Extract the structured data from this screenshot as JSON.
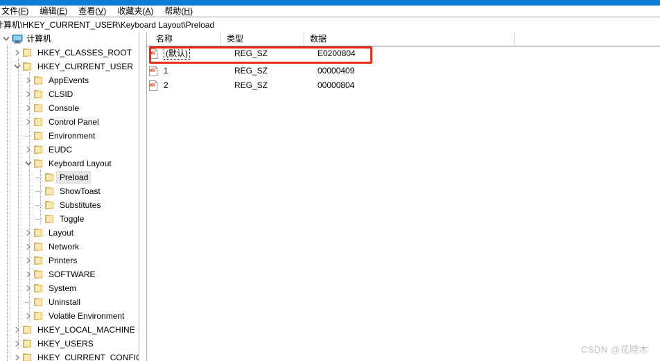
{
  "window": {
    "titlebar_color": "#0b7fd4"
  },
  "menubar": {
    "items": [
      {
        "name": "file",
        "text": "文件(F)",
        "label": "文件",
        "mnemonic": "F"
      },
      {
        "name": "edit",
        "text": "编辑(E)",
        "label": "编辑",
        "mnemonic": "E"
      },
      {
        "name": "view",
        "text": "查看(V)",
        "label": "查看",
        "mnemonic": "V"
      },
      {
        "name": "favorites",
        "text": "收藏夹(A)",
        "label": "收藏夹",
        "mnemonic": "A"
      },
      {
        "name": "help",
        "text": "帮助(H)",
        "label": "帮助",
        "mnemonic": "H"
      }
    ]
  },
  "address": {
    "path": "计算机\\HKEY_CURRENT_USER\\Keyboard Layout\\Preload"
  },
  "tree": {
    "items": [
      {
        "label": "计算机",
        "depth": 0,
        "icon": "computer-icon",
        "expander": "expanded",
        "selected": false
      },
      {
        "label": "HKEY_CLASSES_ROOT",
        "depth": 1,
        "icon": "folder-icon",
        "expander": "collapsed",
        "selected": false
      },
      {
        "label": "HKEY_CURRENT_USER",
        "depth": 1,
        "icon": "folder-icon",
        "expander": "expanded",
        "selected": false
      },
      {
        "label": "AppEvents",
        "depth": 2,
        "icon": "folder-icon",
        "expander": "collapsed",
        "selected": false
      },
      {
        "label": "CLSID",
        "depth": 2,
        "icon": "folder-icon",
        "expander": "collapsed",
        "selected": false
      },
      {
        "label": "Console",
        "depth": 2,
        "icon": "folder-icon",
        "expander": "collapsed",
        "selected": false
      },
      {
        "label": "Control Panel",
        "depth": 2,
        "icon": "folder-icon",
        "expander": "collapsed",
        "selected": false
      },
      {
        "label": "Environment",
        "depth": 2,
        "icon": "folder-icon",
        "expander": "none",
        "selected": false
      },
      {
        "label": "EUDC",
        "depth": 2,
        "icon": "folder-icon",
        "expander": "collapsed",
        "selected": false
      },
      {
        "label": "Keyboard Layout",
        "depth": 2,
        "icon": "folder-icon",
        "expander": "expanded",
        "selected": false
      },
      {
        "label": "Preload",
        "depth": 3,
        "icon": "folder-icon",
        "expander": "none",
        "selected": true
      },
      {
        "label": "ShowToast",
        "depth": 3,
        "icon": "folder-icon",
        "expander": "none",
        "selected": false
      },
      {
        "label": "Substitutes",
        "depth": 3,
        "icon": "folder-icon",
        "expander": "none",
        "selected": false
      },
      {
        "label": "Toggle",
        "depth": 3,
        "icon": "folder-icon",
        "expander": "none",
        "selected": false
      },
      {
        "label": "Layout",
        "depth": 2,
        "icon": "folder-icon",
        "expander": "collapsed",
        "selected": false
      },
      {
        "label": "Network",
        "depth": 2,
        "icon": "folder-icon",
        "expander": "collapsed",
        "selected": false
      },
      {
        "label": "Printers",
        "depth": 2,
        "icon": "folder-icon",
        "expander": "collapsed",
        "selected": false
      },
      {
        "label": "SOFTWARE",
        "depth": 2,
        "icon": "folder-icon",
        "expander": "collapsed",
        "selected": false
      },
      {
        "label": "System",
        "depth": 2,
        "icon": "folder-icon",
        "expander": "collapsed",
        "selected": false
      },
      {
        "label": "Uninstall",
        "depth": 2,
        "icon": "folder-icon",
        "expander": "none",
        "selected": false
      },
      {
        "label": "Volatile Environment",
        "depth": 2,
        "icon": "folder-icon",
        "expander": "collapsed",
        "selected": false
      },
      {
        "label": "HKEY_LOCAL_MACHINE",
        "depth": 1,
        "icon": "folder-icon",
        "expander": "collapsed",
        "selected": false
      },
      {
        "label": "HKEY_USERS",
        "depth": 1,
        "icon": "folder-icon",
        "expander": "collapsed",
        "selected": false
      },
      {
        "label": "HKEY_CURRENT_CONFIG",
        "depth": 1,
        "icon": "folder-icon",
        "expander": "collapsed",
        "selected": false
      }
    ]
  },
  "list": {
    "columns": [
      {
        "key": "name",
        "label": "名称"
      },
      {
        "key": "type",
        "label": "类型"
      },
      {
        "key": "data",
        "label": "数据"
      }
    ],
    "rows": [
      {
        "icon": "string-value-icon",
        "name": "(默认)",
        "type": "REG_SZ",
        "data": "E0200804",
        "focused": true,
        "highlighted": true
      },
      {
        "icon": "string-value-icon",
        "name": "1",
        "type": "REG_SZ",
        "data": "00000409",
        "focused": false,
        "highlighted": false
      },
      {
        "icon": "string-value-icon",
        "name": "2",
        "type": "REG_SZ",
        "data": "00000804",
        "focused": false,
        "highlighted": false
      }
    ],
    "annotation": {
      "name": "red-highlight-box",
      "color": "#ee2b19",
      "target_row": "(默认)"
    }
  },
  "watermark": {
    "text": "CSDN @花晓木",
    "color": "#bfbfbf"
  }
}
